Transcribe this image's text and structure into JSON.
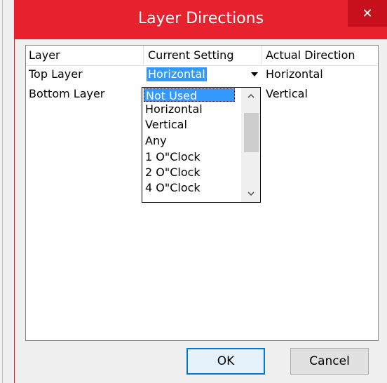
{
  "window": {
    "title": "Layer Directions",
    "close_glyph": "✕",
    "title_bar_color": "#e8212e"
  },
  "table": {
    "headers": [
      "Layer",
      "Current Setting",
      "Actual Direction"
    ],
    "rows": [
      {
        "layer": "Top Layer",
        "current_setting": "Horizontal",
        "actual_direction": "Horizontal"
      },
      {
        "layer": "Bottom Layer",
        "current_setting": "Not Used",
        "actual_direction": "Vertical"
      }
    ]
  },
  "combo": {
    "value": "Horizontal",
    "arrow_icon": "dropdown-arrow-icon"
  },
  "dropdown": {
    "options": [
      "Not Used",
      "Horizontal",
      "Vertical",
      "Any",
      "1 O\"Clock",
      "2 O\"Clock",
      "4 O\"Clock"
    ],
    "selected": "Not Used"
  },
  "buttons": {
    "ok": "OK",
    "cancel": "Cancel"
  }
}
